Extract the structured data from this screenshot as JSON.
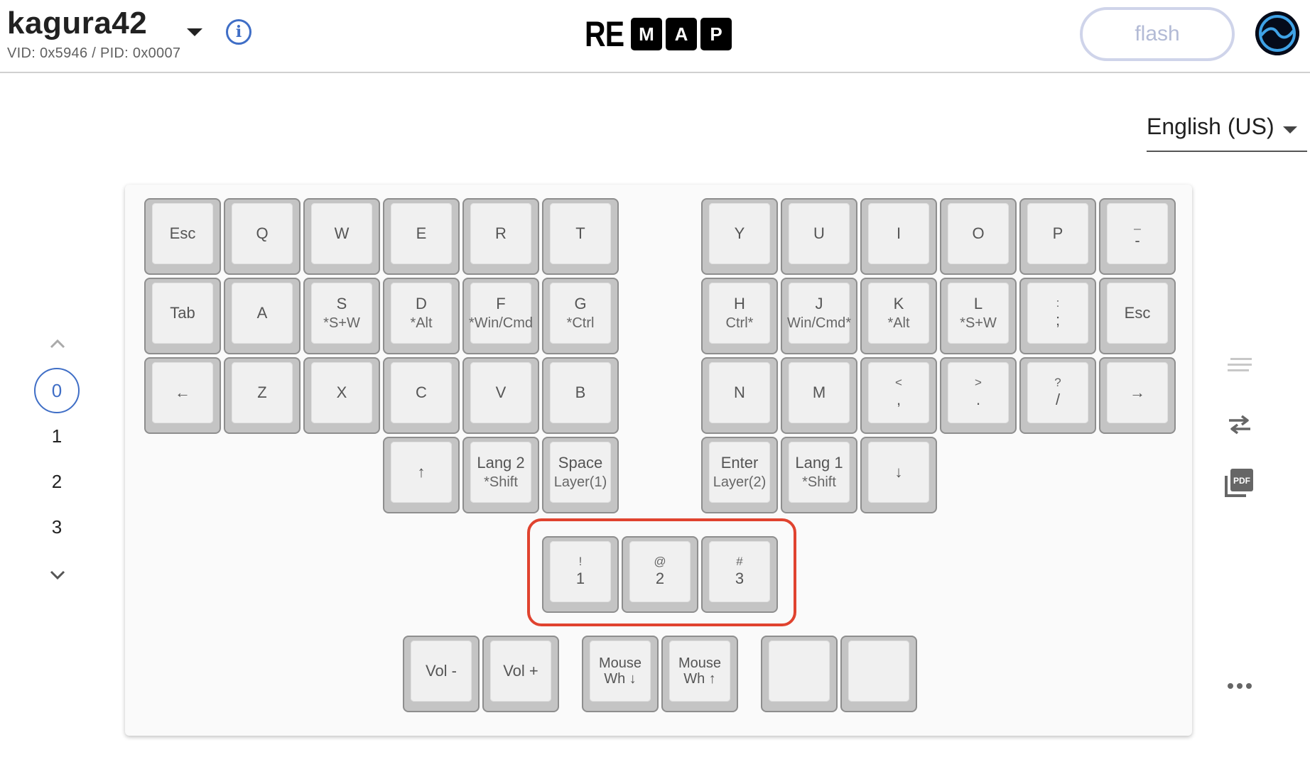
{
  "header": {
    "keyboard_name": "kagura42",
    "ids": "VID: 0x5946 / PID: 0x0007",
    "logo_re": "RE",
    "logo_letters": [
      "M",
      "A",
      "P"
    ],
    "flash_label": "flash"
  },
  "language": {
    "selected": "English (US)"
  },
  "layers": {
    "items": [
      "0",
      "1",
      "2",
      "3"
    ],
    "selected": "0"
  },
  "keys": {
    "r0": [
      {
        "main": "Esc"
      },
      {
        "main": "Q"
      },
      {
        "main": "W"
      },
      {
        "main": "E"
      },
      {
        "main": "R"
      },
      {
        "main": "T"
      },
      {
        "main": "Y"
      },
      {
        "main": "U"
      },
      {
        "main": "I"
      },
      {
        "main": "O"
      },
      {
        "main": "P"
      },
      {
        "top": "_",
        "main": "-"
      }
    ],
    "r1": [
      {
        "main": "Tab"
      },
      {
        "main": "A"
      },
      {
        "main": "S",
        "sub": "*S+W"
      },
      {
        "main": "D",
        "sub": "*Alt"
      },
      {
        "main": "F",
        "sub": "*Win/Cmd"
      },
      {
        "main": "G",
        "sub": "*Ctrl"
      },
      {
        "main": "H",
        "sub": "Ctrl*"
      },
      {
        "main": "J",
        "sub": "Win/Cmd*"
      },
      {
        "main": "K",
        "sub": "*Alt"
      },
      {
        "main": "L",
        "sub": "*S+W"
      },
      {
        "top": ":",
        "main": ";"
      },
      {
        "main": "Esc"
      }
    ],
    "r2": [
      {
        "main": "←"
      },
      {
        "main": "Z"
      },
      {
        "main": "X"
      },
      {
        "main": "C"
      },
      {
        "main": "V"
      },
      {
        "main": "B"
      },
      {
        "main": "N"
      },
      {
        "main": "M"
      },
      {
        "top": "<",
        "main": ","
      },
      {
        "top": ">",
        "main": "."
      },
      {
        "top": "?",
        "main": "/"
      },
      {
        "main": "→"
      }
    ],
    "r3": [
      {
        "main": "↑"
      },
      {
        "main": "Lang 2",
        "sub": "*Shift"
      },
      {
        "main": "Space",
        "sub": "Layer(1)"
      },
      {
        "main": "Enter",
        "sub": "Layer(2)"
      },
      {
        "main": "Lang 1",
        "sub": "*Shift"
      },
      {
        "main": "↓"
      }
    ],
    "r4": [
      {
        "top": "!",
        "main": "1"
      },
      {
        "top": "@",
        "main": "2"
      },
      {
        "top": "#",
        "main": "3"
      }
    ],
    "r5": [
      {
        "main": "Vol -"
      },
      {
        "main": "Vol +"
      },
      {
        "small1": "Mouse",
        "small2": "Wh ↓"
      },
      {
        "small1": "Mouse",
        "small2": "Wh ↑"
      },
      {
        "main": ""
      },
      {
        "main": ""
      }
    ]
  },
  "icons": [
    "info-icon",
    "dropdown-caret-icon",
    "avatar-icon",
    "chevron-up-icon",
    "chevron-down-icon",
    "list-lines-icon",
    "swap-arrows-icon",
    "pdf-icon",
    "more-dots-icon"
  ],
  "colors": {
    "accent": "#3f6ec6",
    "highlight": "#e0432f",
    "flash_border": "#cfd4ea"
  }
}
